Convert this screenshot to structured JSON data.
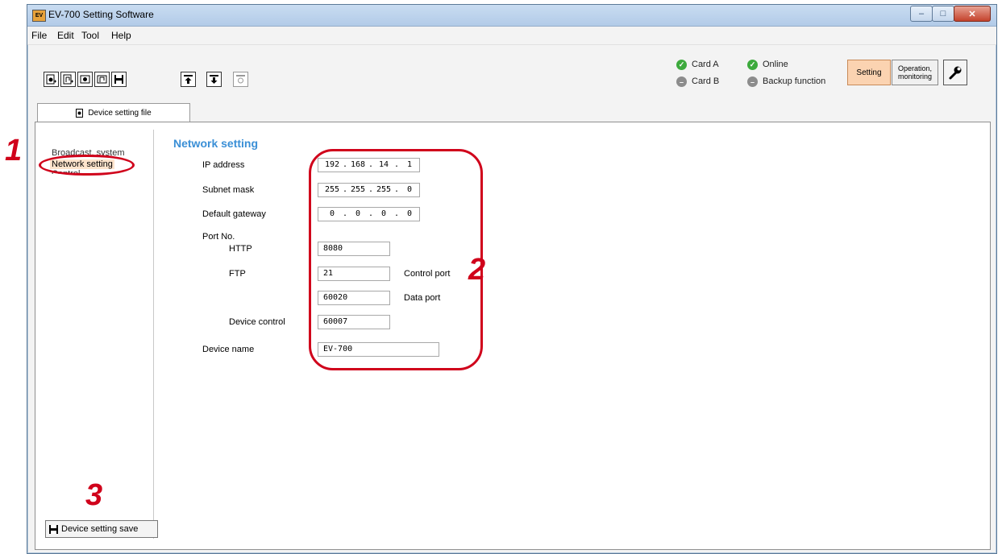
{
  "window": {
    "title": "EV-700 Setting Software",
    "app_icon_text": "EV",
    "controls": {
      "minimize": "–",
      "maximize": "□",
      "close": "✕"
    }
  },
  "menu": [
    "File",
    "Edit",
    "Tool",
    "Help"
  ],
  "toolbar": {
    "file_buttons": [
      "new-settings-icon",
      "new-program-icon",
      "open-settings-icon",
      "open-program-icon",
      "save-icon"
    ],
    "transfer_buttons": [
      "upload-icon",
      "download-icon",
      "sync-icon"
    ]
  },
  "status": {
    "card_a": {
      "label": "Card A",
      "state": "ok"
    },
    "card_b": {
      "label": "Card B",
      "state": "off"
    },
    "online": {
      "label": "Online",
      "state": "ok"
    },
    "backup": {
      "label": "Backup function",
      "state": "off"
    }
  },
  "modes": {
    "setting": "Setting",
    "operation": "Operation,\nmonitoring"
  },
  "tab": {
    "label": "Device setting file"
  },
  "nav": {
    "items": [
      "Broadcast, system",
      "Network setting",
      "Control"
    ],
    "save_button": "Device setting save"
  },
  "form": {
    "section_title": "Network setting",
    "ip_address": {
      "label": "IP address",
      "octets": [
        "192",
        "168",
        "14",
        "1"
      ]
    },
    "subnet_mask": {
      "label": "Subnet mask",
      "octets": [
        "255",
        "255",
        "255",
        "0"
      ]
    },
    "default_gateway": {
      "label": "Default gateway",
      "octets": [
        "0",
        "0",
        "0",
        "0"
      ]
    },
    "port_no": {
      "label": "Port No.",
      "http": {
        "label": "HTTP",
        "value": "8080"
      },
      "ftp": {
        "label": "FTP",
        "control_value": "21",
        "control_label": "Control port",
        "data_value": "60020",
        "data_label": "Data port"
      },
      "device_control": {
        "label": "Device control",
        "value": "60007"
      }
    },
    "device_name": {
      "label": "Device name",
      "value": "EV-700"
    }
  },
  "annotations": {
    "one": "1",
    "two": "2",
    "three": "3"
  },
  "colors": {
    "section_title": "#3a8fd6",
    "annotation": "#d0021b",
    "setting_active": "#fbd3b1",
    "ok": "#3daa3d"
  }
}
